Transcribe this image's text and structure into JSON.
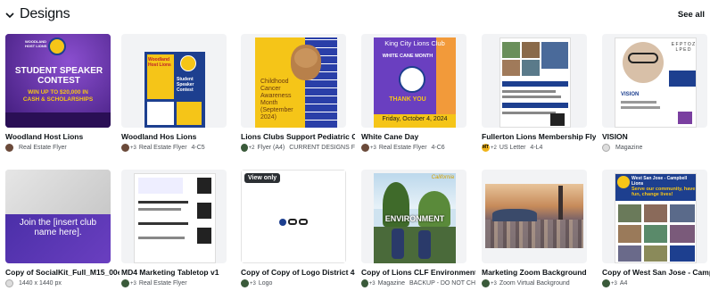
{
  "section": {
    "title": "Designs",
    "see_all": "See all"
  },
  "row1": [
    {
      "name": "Woodland Host Lions",
      "avatar": "pc",
      "count": "",
      "type": "Real Estate Flyer",
      "dims": "",
      "thumb_text": [
        "WOODLAND HOST LIONS",
        "STUDENT SPEAKER CONTEST",
        "WIN UP TO $20,000 IN CASH & SCHOLARSHIPS"
      ]
    },
    {
      "name": "Woodland Hos Lions",
      "avatar": "pc",
      "count": "+3",
      "type": "Real Estate Flyer",
      "dims": "4-C5",
      "thumb_text": [
        "Woodland Host Lions",
        "Student Speaker Contest"
      ]
    },
    {
      "name": "Lions Clubs Support Pediatric C...",
      "avatar": "pd",
      "count": "+2",
      "type": "Flyer (A4)",
      "dims": "CURRENT DESIGNS F",
      "thumb_text": [
        "Childhood Cancer Awareness Month (September 2024)"
      ]
    },
    {
      "name": "White Cane Day",
      "avatar": "pc",
      "count": "+3",
      "type": "Real Estate Flyer",
      "dims": "4-C6",
      "thumb_text": [
        "King City Lions Club",
        "WHITE CANE MONTH",
        "THANK YOU",
        "Friday, October 4, 2024"
      ]
    },
    {
      "name": "Fullerton Lions Membership Fly...",
      "avatar": "pm",
      "count": "+2",
      "type": "US Letter",
      "dims": "4-L4",
      "thumb_text": []
    },
    {
      "name": "VISION",
      "avatar": "pt",
      "count": "",
      "type": "Magazine",
      "dims": "",
      "thumb_text": [
        "VISION"
      ]
    }
  ],
  "row2": [
    {
      "name": "Copy of SocialKit_Full_M15_00e",
      "avatar": "pt",
      "count": "",
      "type": "1440 x 1440 px",
      "dims": "",
      "thumb_text": [
        "Join the [insert club name here]."
      ]
    },
    {
      "name": "MD4 Marketing Tabletop v1",
      "avatar": "pd",
      "count": "+3",
      "type": "Real Estate Flyer",
      "dims": "",
      "thumb_text": []
    },
    {
      "name": "Copy of Copy of Logo District 4-...",
      "avatar": "pd",
      "count": "+3",
      "type": "Logo",
      "dims": "",
      "badge": "View only",
      "thumb_text": []
    },
    {
      "name": "Copy of Lions CLF Environment ...",
      "avatar": "pd",
      "count": "+3",
      "type": "Magazine",
      "dims": "BACKUP - DO NOT CH",
      "thumb_text": [
        "ENVIRONMENT",
        "California"
      ]
    },
    {
      "name": "Marketing Zoom Background",
      "avatar": "pd",
      "count": "+3",
      "type": "Zoom Virtual Background",
      "dims": "",
      "thumb_text": []
    },
    {
      "name": "Copy of West San Jose - Campb...",
      "avatar": "pd",
      "count": "+3",
      "type": "A4",
      "dims": "",
      "thumb_text": [
        "West San Jose - Campbell Lions",
        "Serve our community, have fun, change lives!"
      ]
    }
  ],
  "colors": {
    "lions_blue": "#1d3f8f",
    "lions_yellow": "#f5c518",
    "purple": "#5b2fa0"
  }
}
